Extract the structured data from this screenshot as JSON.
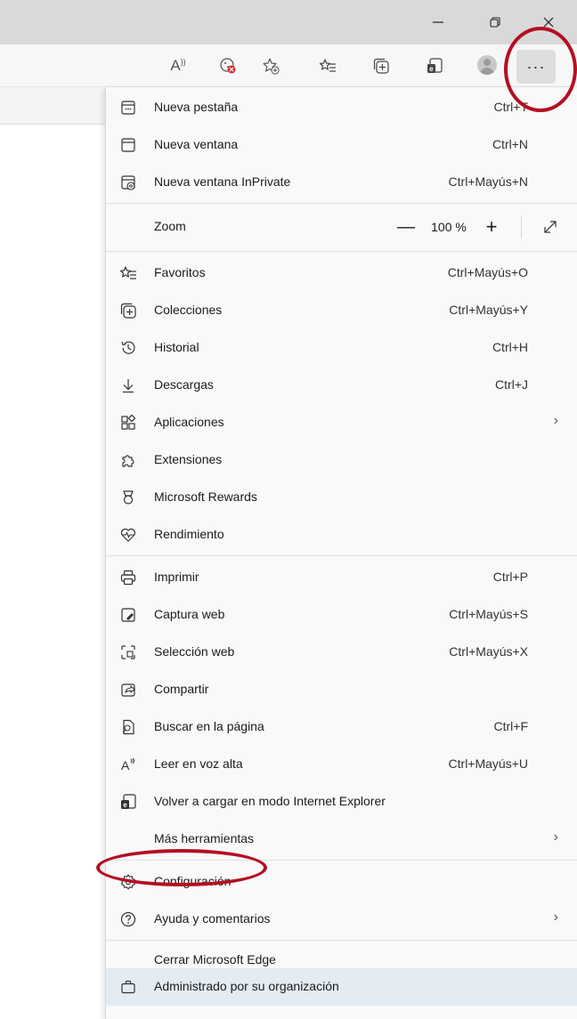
{
  "window": {
    "minimize_icon": "minimize-icon",
    "maximize_icon": "restore-icon",
    "close_icon": "close-icon"
  },
  "toolbar": {
    "more_label": "···"
  },
  "menu": {
    "items": [
      {
        "label": "Nueva pestaña",
        "shortcut": "Ctrl+T",
        "icon": "new-tab-icon"
      },
      {
        "label": "Nueva ventana",
        "shortcut": "Ctrl+N",
        "icon": "new-window-icon"
      },
      {
        "label": "Nueva ventana InPrivate",
        "shortcut": "Ctrl+Mayús+N",
        "icon": "inprivate-icon"
      },
      {
        "label": "Zoom",
        "shortcut": "",
        "icon": ""
      },
      {
        "label": "Favoritos",
        "shortcut": "Ctrl+Mayús+O",
        "icon": "favorites-icon"
      },
      {
        "label": "Colecciones",
        "shortcut": "Ctrl+Mayús+Y",
        "icon": "collections-icon"
      },
      {
        "label": "Historial",
        "shortcut": "Ctrl+H",
        "icon": "history-icon"
      },
      {
        "label": "Descargas",
        "shortcut": "Ctrl+J",
        "icon": "download-icon"
      },
      {
        "label": "Aplicaciones",
        "shortcut": "",
        "icon": "apps-icon"
      },
      {
        "label": "Extensiones",
        "shortcut": "",
        "icon": "extensions-icon"
      },
      {
        "label": "Microsoft Rewards",
        "shortcut": "",
        "icon": "rewards-icon"
      },
      {
        "label": "Rendimiento",
        "shortcut": "",
        "icon": "performance-icon"
      },
      {
        "label": "Imprimir",
        "shortcut": "Ctrl+P",
        "icon": "print-icon"
      },
      {
        "label": "Captura web",
        "shortcut": "Ctrl+Mayús+S",
        "icon": "web-capture-icon"
      },
      {
        "label": "Selección web",
        "shortcut": "Ctrl+Mayús+X",
        "icon": "web-select-icon"
      },
      {
        "label": "Compartir",
        "shortcut": "",
        "icon": "share-icon"
      },
      {
        "label": "Buscar en la página",
        "shortcut": "Ctrl+F",
        "icon": "find-icon"
      },
      {
        "label": "Leer en voz alta",
        "shortcut": "Ctrl+Mayús+U",
        "icon": "read-aloud-icon"
      },
      {
        "label": "Volver a cargar en modo Internet Explorer",
        "shortcut": "",
        "icon": "ie-mode-icon"
      },
      {
        "label": "Más herramientas",
        "shortcut": "",
        "icon": ""
      },
      {
        "label": "Configuración",
        "shortcut": "",
        "icon": "gear-icon"
      },
      {
        "label": "Ayuda y comentarios",
        "shortcut": "",
        "icon": "help-icon"
      },
      {
        "label": "Cerrar Microsoft Edge",
        "shortcut": "",
        "icon": ""
      },
      {
        "label": "Administrado por su organización",
        "shortcut": "",
        "icon": "briefcase-icon"
      }
    ],
    "zoom_value": "100 %",
    "zoom_minus": "—",
    "zoom_plus": "+",
    "submenu_chevron": "›"
  },
  "colors": {
    "highlight": "#b40e22",
    "managed_bg": "#e3ebf3"
  }
}
